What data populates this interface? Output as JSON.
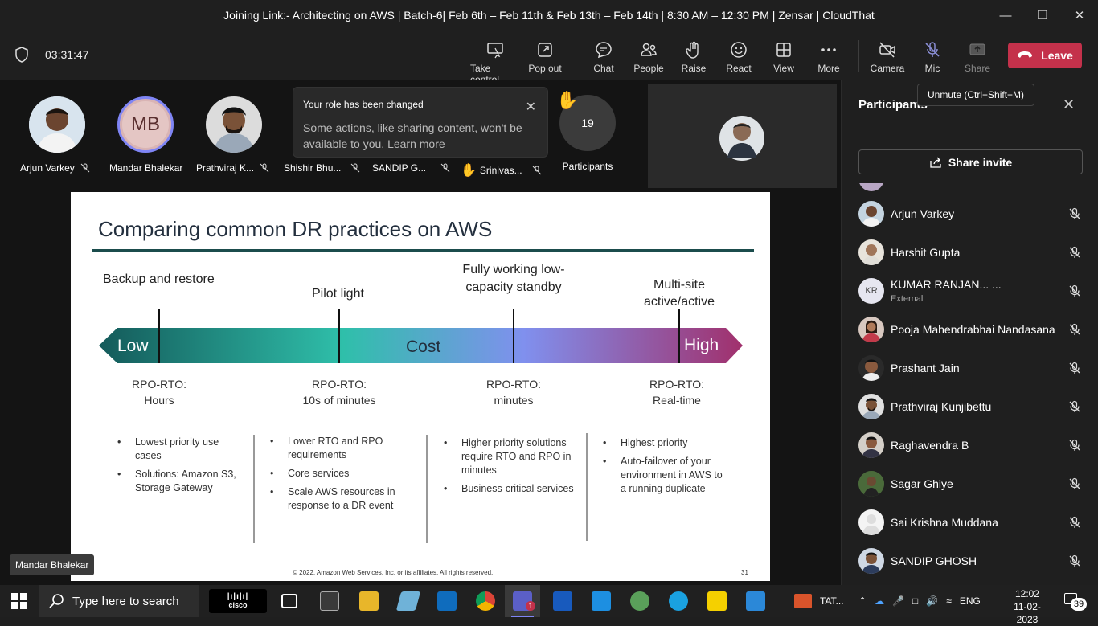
{
  "window": {
    "title": "Joining Link:- Architecting on AWS | Batch-6| Feb 6th – Feb 11th & Feb 13th – Feb 14th | 8:30 AM – 12:30 PM | Zensar | CloudThat"
  },
  "toolbar": {
    "timer": "03:31:47",
    "take_control": "Take control",
    "pop_out": "Pop out",
    "chat": "Chat",
    "people": "People",
    "raise": "Raise",
    "react": "React",
    "view": "View",
    "more": "More",
    "camera": "Camera",
    "mic": "Mic",
    "share": "Share",
    "leave": "Leave",
    "mic_tooltip": "Unmute (Ctrl+Shift+M)"
  },
  "gallery": {
    "people": [
      {
        "name": "Arjun Varkey"
      },
      {
        "name": "Mandar Bhalekar",
        "initials": "MB"
      },
      {
        "name": "Prathviraj K..."
      },
      {
        "name": "Shishir Bhu..."
      },
      {
        "name": "SANDIP G..."
      },
      {
        "name": "Srinivas..."
      }
    ],
    "participants_count": "19",
    "participants_label": "Participants"
  },
  "toast": {
    "title": "Your role has been changed",
    "body": "Some actions, like sharing content, won't be available to you. Learn more"
  },
  "slide": {
    "title": "Comparing common DR practices on AWS",
    "stages": [
      {
        "name": "Backup and restore",
        "rpo_label": "RPO-RTO:",
        "rpo_value": "Hours",
        "bullets": [
          "Lowest priority use cases",
          "Solutions: Amazon S3, Storage Gateway"
        ]
      },
      {
        "name": "Pilot light",
        "rpo_label": "RPO-RTO:",
        "rpo_value": "10s of minutes",
        "bullets": [
          "Lower RTO and RPO requirements",
          "Core services",
          "Scale AWS resources in response to a DR event"
        ]
      },
      {
        "name": "Fully working low-capacity standby",
        "rpo_label": "RPO-RTO:",
        "rpo_value": "minutes",
        "bullets": [
          "Higher priority solutions require RTO and RPO in minutes",
          "Business-critical services"
        ]
      },
      {
        "name": "Multi-site active/active",
        "rpo_label": "RPO-RTO:",
        "rpo_value": "Real-time",
        "bullets": [
          "Highest priority",
          "Auto-failover of your environment in AWS to a running duplicate"
        ]
      }
    ],
    "arrow_low": "Low",
    "arrow_cost": "Cost",
    "arrow_high": "High",
    "footer": "© 2022, Amazon Web Services, Inc. or its affiliates. All rights reserved.",
    "page": "31",
    "presenter": "Mandar Bhalekar"
  },
  "panel": {
    "title": "Participants",
    "share_invite": "Share invite",
    "participants": [
      {
        "name": "Arjun Varkey"
      },
      {
        "name": "Harshit Gupta"
      },
      {
        "name": "KUMAR RANJAN... ...",
        "sub": "External",
        "initials": "KR"
      },
      {
        "name": "Pooja Mahendrabhai Nandasana"
      },
      {
        "name": "Prashant Jain"
      },
      {
        "name": "Prathviraj Kunjibettu"
      },
      {
        "name": "Raghavendra B"
      },
      {
        "name": "Sagar Ghiye"
      },
      {
        "name": "Sai Krishna Muddana"
      },
      {
        "name": "SANDIP GHOSH"
      }
    ]
  },
  "taskbar": {
    "search_placeholder": "Type here to search",
    "cisco": "cisco",
    "tata": "TAT...",
    "lang": "ENG",
    "time": "12:02",
    "date": "11-02-2023",
    "notif_count": "39",
    "teams_badge": "1"
  },
  "colors": {
    "accent": "#7f85f5",
    "leave": "#c4314b",
    "slide_rule": "#1b4c4c"
  }
}
